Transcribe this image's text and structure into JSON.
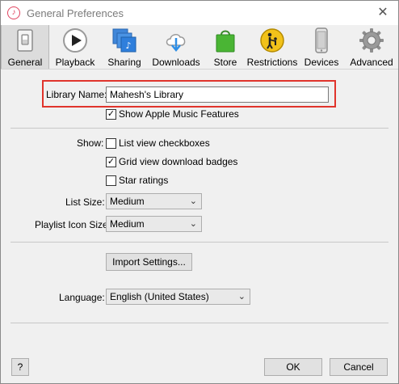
{
  "window": {
    "title": "General Preferences",
    "close_glyph": "✕",
    "app_icon": "music-note-icon"
  },
  "toolbar": {
    "items": [
      {
        "label": "General",
        "icon": "switch-icon",
        "selected": true
      },
      {
        "label": "Playback",
        "icon": "play-icon",
        "selected": false
      },
      {
        "label": "Sharing",
        "icon": "sharing-icon",
        "selected": false
      },
      {
        "label": "Downloads",
        "icon": "cloud-download-icon",
        "selected": false
      },
      {
        "label": "Store",
        "icon": "shopping-bag-icon",
        "selected": false
      },
      {
        "label": "Restrictions",
        "icon": "parental-restrictions-icon",
        "selected": false
      },
      {
        "label": "Devices",
        "icon": "phone-icon",
        "selected": false
      },
      {
        "label": "Advanced",
        "icon": "gear-icon",
        "selected": false
      }
    ]
  },
  "library": {
    "label": "Library Name:",
    "value": "Mahesh's Library",
    "highlight_color": "#e0342c"
  },
  "apple_music": {
    "label": "Show Apple Music Features",
    "checked": true
  },
  "show": {
    "label": "Show:",
    "options": [
      {
        "label": "List view checkboxes",
        "checked": false
      },
      {
        "label": "Grid view download badges",
        "checked": true
      },
      {
        "label": "Star ratings",
        "checked": false
      }
    ]
  },
  "list_size": {
    "label": "List Size:",
    "value": "Medium"
  },
  "playlist_icon_size": {
    "label": "Playlist Icon Size:",
    "value": "Medium"
  },
  "import_button": {
    "label": "Import Settings..."
  },
  "language": {
    "label": "Language:",
    "value": "English (United States)"
  },
  "footer": {
    "help_label": "?",
    "ok_label": "OK",
    "cancel_label": "Cancel"
  },
  "check_glyph": "✓",
  "chevron_glyph": "⌄"
}
